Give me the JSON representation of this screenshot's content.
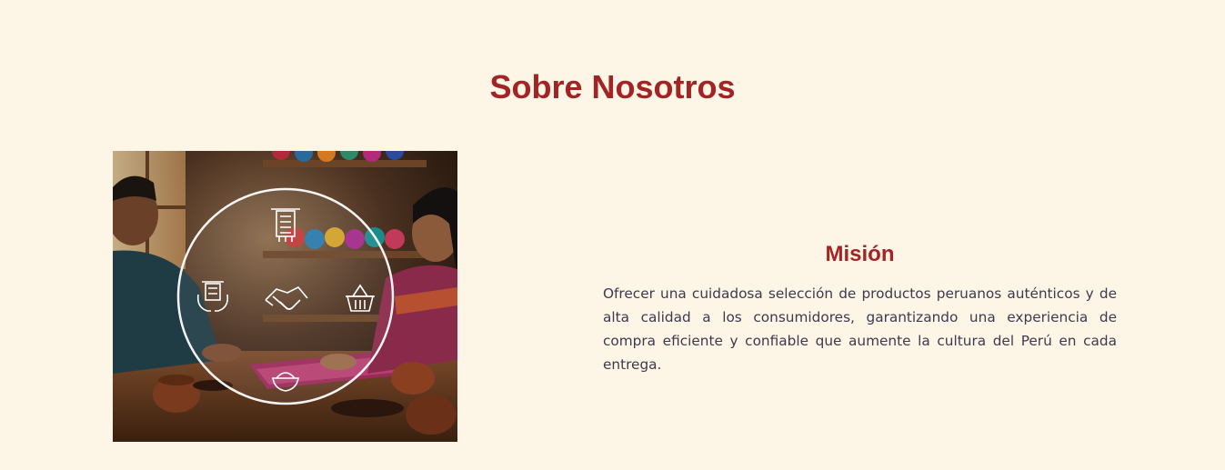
{
  "section": {
    "title": "Sobre Nosotros"
  },
  "image": {
    "description_icons": [
      "loom-icon",
      "hands-loom-icon",
      "handshake-icon",
      "basket-icon",
      "bowl-icon"
    ]
  },
  "mission": {
    "title": "Misión",
    "text": "Ofrecer una cuidadosa selección de productos peruanos auténticos y de alta calidad a los consumidores, garantizando una experiencia de compra eficiente y confiable que aumente la cultura del Perú en cada entrega."
  },
  "colors": {
    "background": "#fdf5e6",
    "accent": "#a32424",
    "body_text": "#3e3a4e"
  }
}
